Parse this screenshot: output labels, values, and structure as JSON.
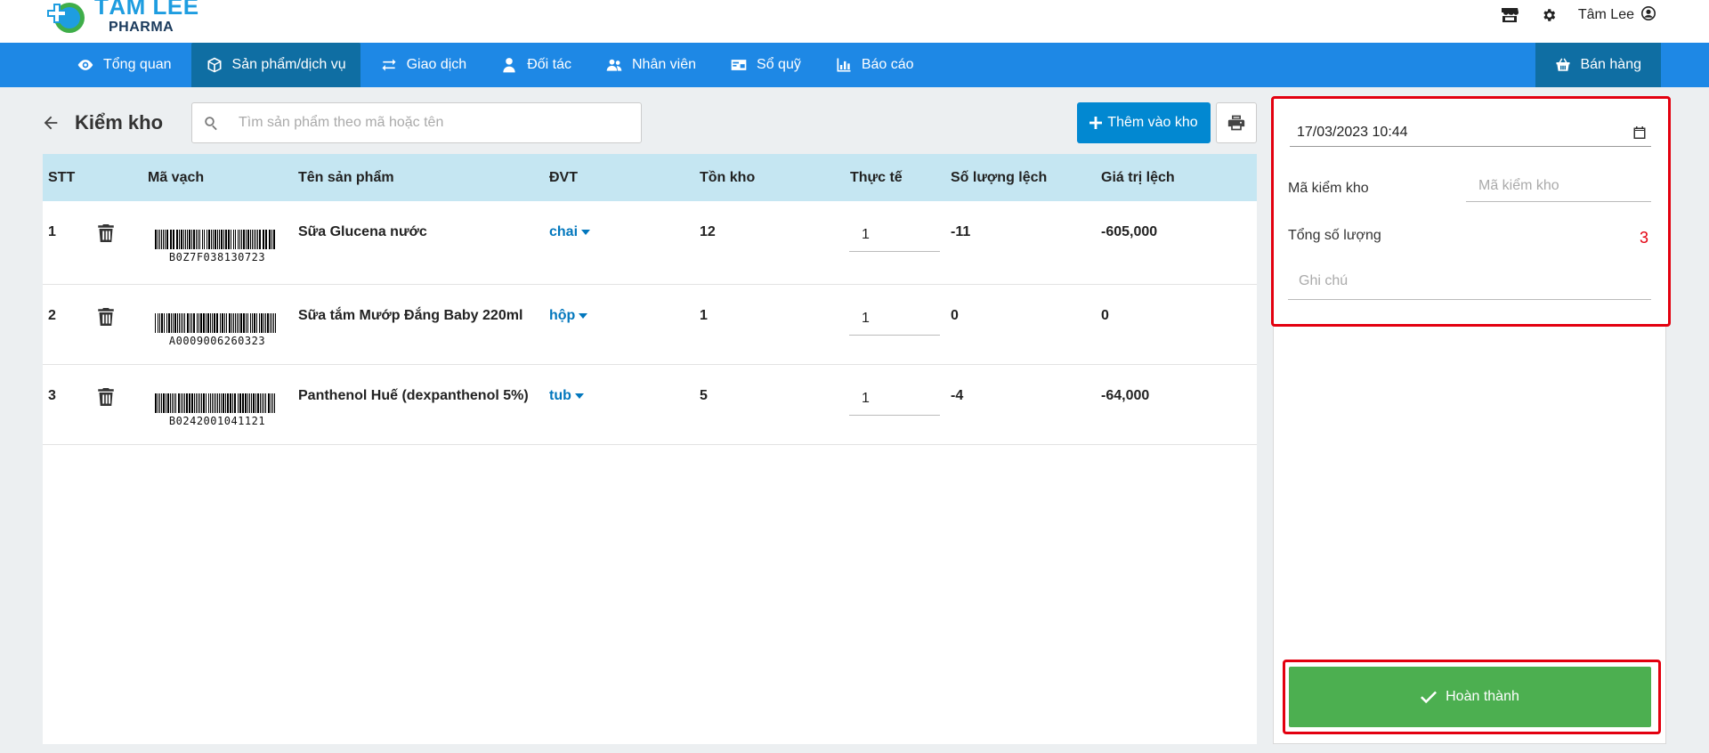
{
  "header": {
    "brand": "TÂM LEE",
    "brand_sub": "PHARMA",
    "user_name": "Tâm Lee",
    "icons": [
      "store-icon",
      "gear-icon",
      "user-circle-icon"
    ]
  },
  "nav": {
    "items": [
      {
        "label": "Tổng quan",
        "icon": "eye-icon"
      },
      {
        "label": "Sản phẩm/dịch vụ",
        "icon": "box-icon"
      },
      {
        "label": "Giao dịch",
        "icon": "exchange-icon"
      },
      {
        "label": "Đối tác",
        "icon": "user-tie-icon"
      },
      {
        "label": "Nhân viên",
        "icon": "users-icon"
      },
      {
        "label": "Sổ quỹ",
        "icon": "money-card-icon"
      },
      {
        "label": "Báo cáo",
        "icon": "chart-icon"
      }
    ],
    "active_index": 1,
    "sell_label": "Bán hàng"
  },
  "page": {
    "title": "Kiểm kho",
    "search_placeholder": "Tìm sản phẩm theo mã hoặc tên",
    "add_button": "Thêm vào kho"
  },
  "table": {
    "columns": [
      "STT",
      "Mã vạch",
      "Tên sản phẩm",
      "ĐVT",
      "Tồn kho",
      "Thực tế",
      "Số lượng lệch",
      "Giá trị lệch"
    ],
    "rows": [
      {
        "stt": "1",
        "barcode": "B0Z7F038130723",
        "name": "Sữa Glucena nước",
        "unit": "chai",
        "stock": "12",
        "actual": "1",
        "diff_qty": "-11",
        "diff_value": "-605,000"
      },
      {
        "stt": "2",
        "barcode": "A0009006260323",
        "name": "Sữa tắm Mướp Đắng Baby 220ml",
        "unit": "hộp",
        "stock": "1",
        "actual": "1",
        "diff_qty": "0",
        "diff_value": "0"
      },
      {
        "stt": "3",
        "barcode": "B0242001041121",
        "name": "Panthenol Huế (dexpanthenol 5%)",
        "unit": "tub",
        "stock": "5",
        "actual": "1",
        "diff_qty": "-4",
        "diff_value": "-64,000"
      }
    ]
  },
  "side": {
    "datetime": "17/03/2023 10:44",
    "code_label": "Mã kiểm kho",
    "code_placeholder": "Mã kiểm kho",
    "total_label": "Tổng số lượng",
    "total_value": "3",
    "note_placeholder": "Ghi chú",
    "finish_label": "Hoàn thành"
  },
  "colors": {
    "nav_bg": "#1e88e5",
    "nav_active": "#0f6ea3",
    "table_header": "#c5e6f2",
    "unit_link": "#0277bd",
    "finish_green": "#4caf50",
    "highlight_red": "#e3000f",
    "add_button": "#0288d1"
  }
}
